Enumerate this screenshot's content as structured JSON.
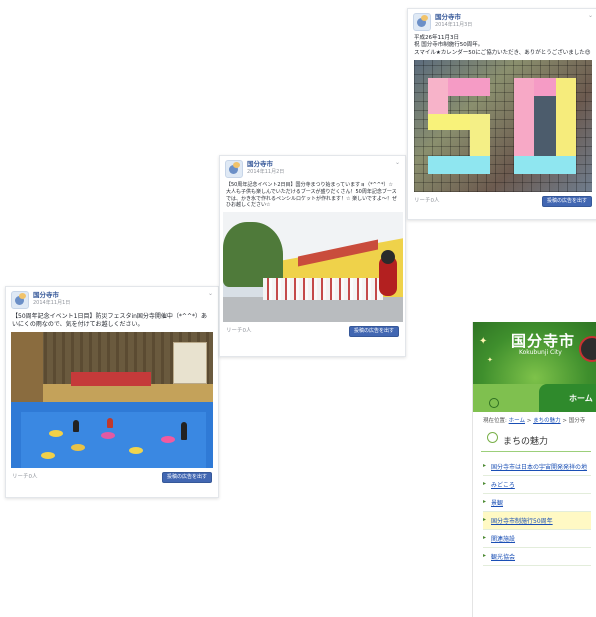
{
  "posts": [
    {
      "page_name": "国分寺市",
      "date": "2014年11月1日",
      "text": "【50周年記念イベント1日目】防災フェスタin国分寺開催中（*^^*）あいにくの雨なので、気を付けてお越しください。",
      "reach": "リーチ0人",
      "button": "投稿の広告を出す"
    },
    {
      "page_name": "国分寺市",
      "date": "2014年11月2日",
      "text": "【50周年記念イベント2日目】国分寺まつり始まっていますョ（*^^*）☆ 大人も子供も楽しんでいただけるブースが盛りだくさん！50周年記念ブースでは、かき氷で作れるペンシルロケットが作れます！☆ 楽しいですよ～！ぜひお越しください☆",
      "reach": "リーチ0人",
      "button": "投稿の広告を出す"
    },
    {
      "page_name": "国分寺市",
      "date": "2014年11月3日",
      "text": "平成26年11月3日\n祝 国分寺市制施行50周年。\nスマイル★カレンダー50にご協力いただき、ありがとうございました😍",
      "reach": "リーチ0人",
      "button": "投稿の広告を出す"
    }
  ],
  "city_site": {
    "title": "国分寺市",
    "subtitle": "Kokubunji City",
    "home_tab": "ホーム",
    "breadcrumb_prefix": "現在位置:",
    "breadcrumb_home": "ホーム",
    "breadcrumb_sep": ">",
    "breadcrumb_section": "まちの魅力",
    "breadcrumb_current": "国分寺",
    "section_title": "まちの魅力",
    "menu_items": [
      "国分寺市は日本の宇宙開発発祥の地",
      "みどころ",
      "景観",
      "国分寺市制施行50周年",
      "関連施設",
      "観光協会"
    ],
    "highlighted_index": 3
  },
  "colors": {
    "fb_blue": "#4267b2",
    "link_blue": "#365899",
    "city_green": "#3f8f2d",
    "mosaic_pink": "#f59bc5",
    "mosaic_yellow": "#f8f27a",
    "mosaic_cyan": "#8fe6f0"
  }
}
